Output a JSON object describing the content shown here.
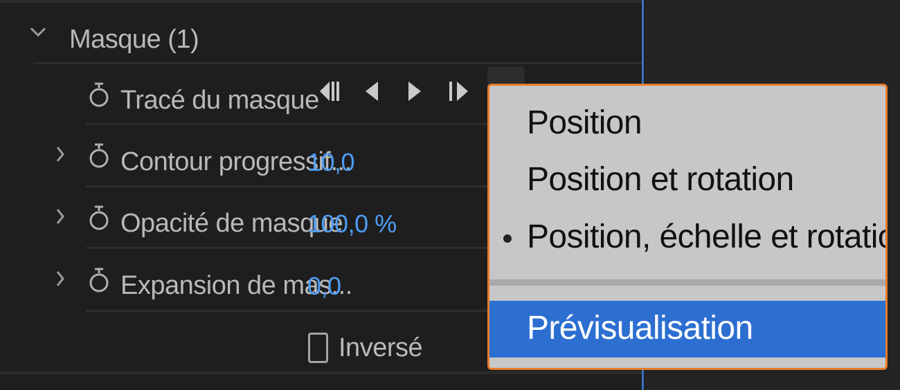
{
  "mask_section": {
    "title": "Masque (1)"
  },
  "properties": [
    {
      "label": "Tracé du masque",
      "value": ""
    },
    {
      "label": "Contour progressif...",
      "value": "10,0"
    },
    {
      "label": "Opacité de masque",
      "value": "100,0 %"
    },
    {
      "label": "Expansion de mas...",
      "value": "0,0"
    }
  ],
  "invert": {
    "label": "Inversé",
    "checked": false
  },
  "tracking_menu": {
    "items": [
      {
        "label": "Position",
        "checked": false
      },
      {
        "label": "Position et rotation",
        "checked": false
      },
      {
        "label": "Position, échelle et rotation",
        "checked": true
      }
    ],
    "preview_label": "Prévisualisation"
  },
  "colors": {
    "accent_blue": "#4f9cf3",
    "highlight_blue": "#2c6fd1",
    "menu_border_orange": "#e97b2c",
    "timeline_line": "#3a6fc4"
  },
  "icons": {
    "stopwatch": "stopwatch-icon",
    "section_toggle": "chevron-down-icon",
    "row_toggle": "chevron-right-icon",
    "keyframe_nav": [
      "track-selected-backward-icon",
      "track-backward-one-frame-icon",
      "track-forward-one-frame-icon",
      "track-selected-forward-icon"
    ]
  }
}
